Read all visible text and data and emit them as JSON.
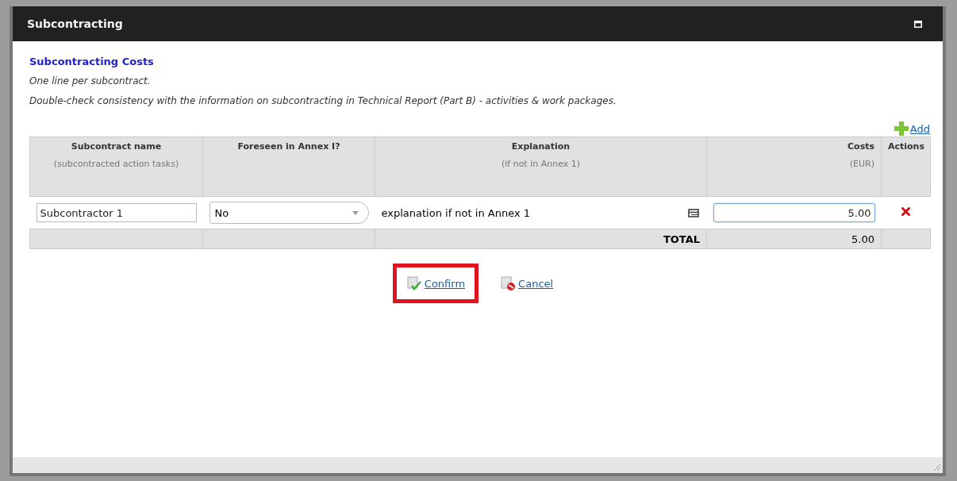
{
  "window": {
    "title": "Subcontracting"
  },
  "section_title": "Subcontracting Costs",
  "notes": [
    "One line per subcontract.",
    "Double-check consistency with the information on subcontracting in Technical Report (Part B) - activities & work packages."
  ],
  "add_link": "Add",
  "table": {
    "columns": [
      {
        "title": "Subcontract name",
        "subtitle": "(subcontracted action tasks)"
      },
      {
        "title": "Foreseen in Annex I?"
      },
      {
        "title": "Explanation",
        "subtitle": "(if not in Annex 1)"
      },
      {
        "title": "Costs",
        "subtitle": "(EUR)"
      },
      {
        "title": "Actions"
      }
    ],
    "rows": [
      {
        "name": "Subcontractor 1",
        "foreseen": "No",
        "explanation": "explanation if not in Annex 1",
        "cost": "5.00",
        "cost_focused": true
      }
    ],
    "total_label": "TOTAL",
    "total": "5.00"
  },
  "actions": [
    {
      "label": "Confirm",
      "kind": "confirm",
      "highlighted": true
    },
    {
      "label": "Cancel",
      "kind": "cancel",
      "highlighted": false
    }
  ]
}
